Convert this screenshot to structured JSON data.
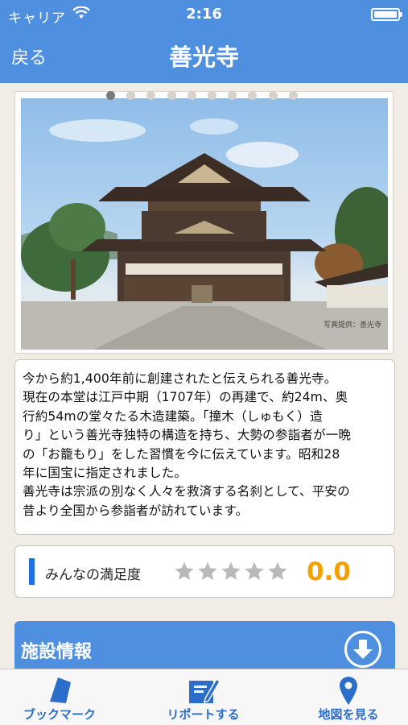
{
  "status_bar": {
    "carrier": "キャリア",
    "time": "2:16"
  },
  "nav": {
    "back_label": "戻る",
    "title": "善光寺"
  },
  "carousel": {
    "page_count": 10,
    "current_page": 1,
    "photo_credit": "写真提供：善光寺"
  },
  "description": {
    "lines": [
      "今から約1,400年前に創建されたと伝えられる善光寺。",
      "現在の本堂は江戸中期（1707年）の再建で、約24m、奥",
      "行約54mの堂々たる木造建築。「撞木（しゅもく）造",
      "り」という善光寺独特の構造を持ち、大勢の参詣者が一晩",
      "の「お籠もり」をした習慣を今に伝えています。昭和28",
      "年に国宝に指定されました。",
      "善光寺は宗派の別なく人々を救済する名刹として、平安の",
      "昔より全国から参詣者が訪れています。"
    ]
  },
  "rating": {
    "label": "みんなの満足度",
    "value": "0.0",
    "stars_filled": 0,
    "stars_total": 5
  },
  "facility": {
    "title": "施設情報"
  },
  "tabs": [
    {
      "label": "ブックマーク",
      "icon": "bookmark-icon"
    },
    {
      "label": "リポートする",
      "icon": "report-edit-icon"
    },
    {
      "label": "地図を見る",
      "icon": "map-pin-icon"
    }
  ],
  "colors": {
    "header": "#4f8fe0",
    "accent": "#1f6fe0",
    "rating": "#f4a100",
    "background": "#f1ede6"
  }
}
